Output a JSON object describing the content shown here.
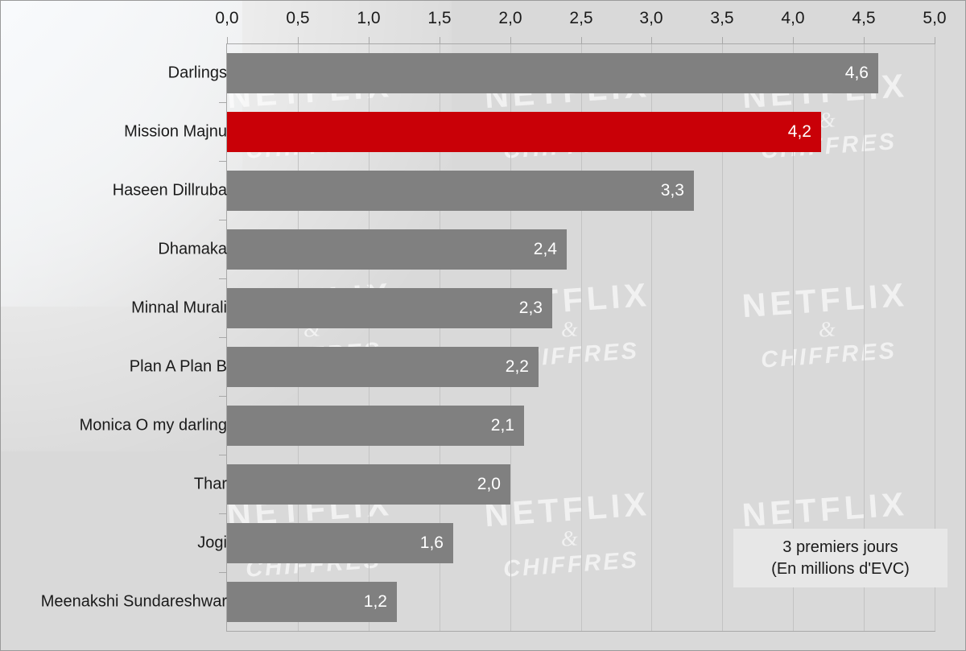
{
  "chart_data": {
    "type": "bar",
    "orientation": "horizontal",
    "title": "",
    "subtitle": "",
    "xlabel": "",
    "ylabel": "",
    "xlim": [
      0.0,
      5.0
    ],
    "xtick_step": 0.5,
    "grid": true,
    "decimal_separator": ",",
    "categories": [
      "Darlings",
      "Mission Majnu",
      "Haseen Dillruba",
      "Dhamaka",
      "Minnal Murali",
      "Plan A Plan B",
      "Monica O my darling",
      "Thar",
      "Jogi",
      "Meenakshi Sundareshwar"
    ],
    "values": [
      4.6,
      4.2,
      3.3,
      2.4,
      2.3,
      2.2,
      2.1,
      2.0,
      1.6,
      1.2
    ],
    "value_labels": [
      "4,6",
      "4,2",
      "3,3",
      "2,4",
      "2,3",
      "2,2",
      "2,1",
      "2,0",
      "1,6",
      "1,2"
    ],
    "highlight_index": 1,
    "bar_colors": [
      "#808080",
      "#c90007",
      "#808080",
      "#808080",
      "#808080",
      "#808080",
      "#808080",
      "#808080",
      "#808080",
      "#808080"
    ],
    "xtick_labels": [
      "0,0",
      "0,5",
      "1,0",
      "1,5",
      "2,0",
      "2,5",
      "3,0",
      "3,5",
      "4,0",
      "4,5",
      "5,0"
    ],
    "xtick_values": [
      0.0,
      0.5,
      1.0,
      1.5,
      2.0,
      2.5,
      3.0,
      3.5,
      4.0,
      4.5,
      5.0
    ],
    "legend_position": "bottom-right",
    "annotations": [
      "3 premiers jours",
      "(En millions d'EVC)"
    ]
  },
  "legend": {
    "line1": "3 premiers jours",
    "line2": "(En millions d'EVC)"
  },
  "watermark": {
    "line1": "NETFLIX",
    "line2": "&",
    "line3": "CHIFFRES"
  },
  "colors": {
    "background": "#d9d9d9",
    "bar_default": "#808080",
    "bar_highlight": "#c90007",
    "gridline": "#c3c3c3",
    "axis": "#a8a8a8",
    "text": "#1a1a1a",
    "value_text": "#ffffff",
    "legend_background": "#e7e7e7",
    "border": "#9a9a9a"
  }
}
